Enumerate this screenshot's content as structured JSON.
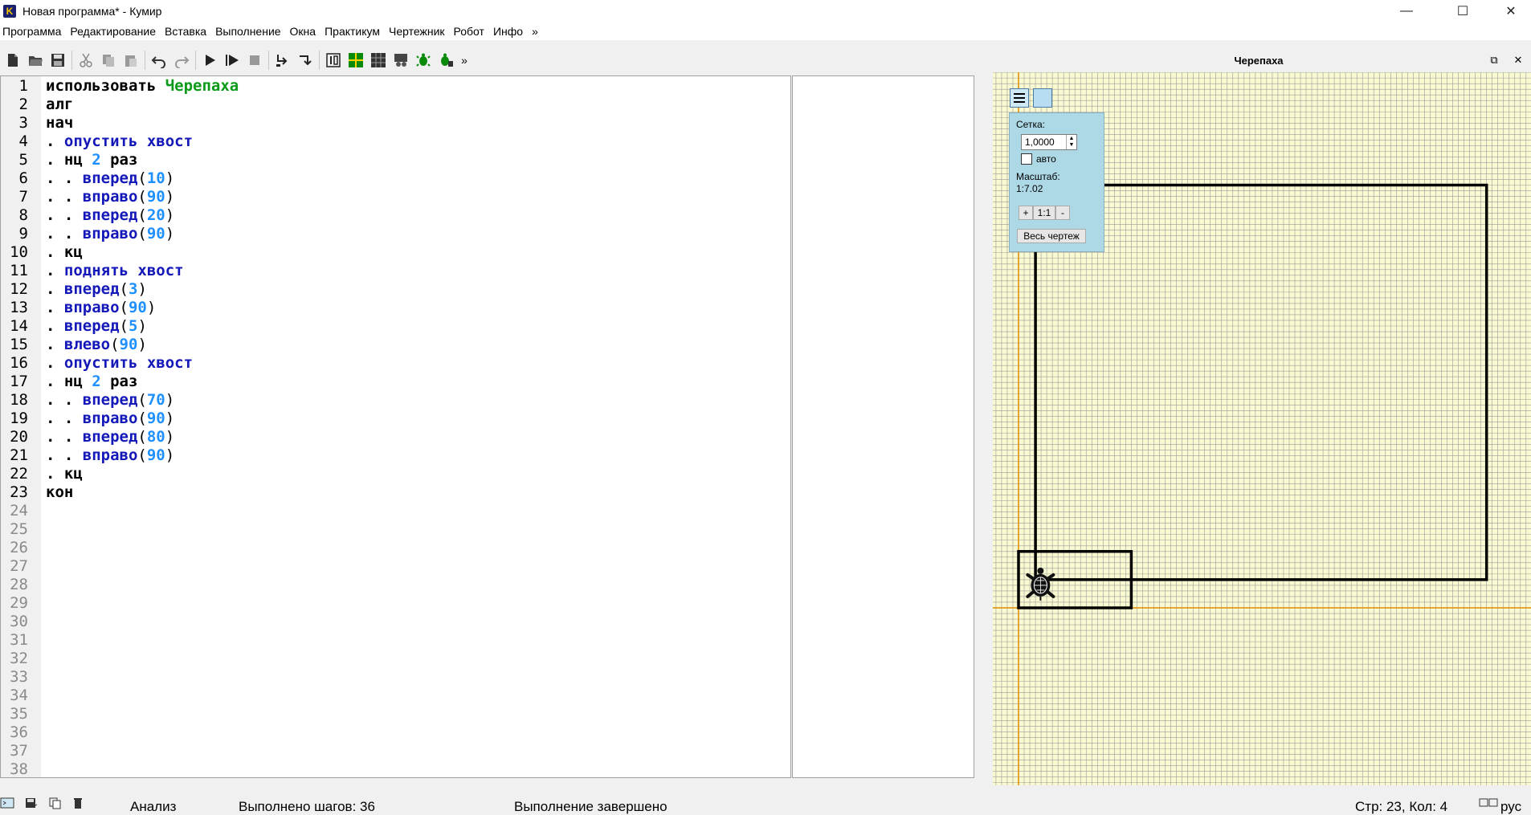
{
  "window": {
    "title": "Новая программа* - Кумир",
    "logo": "K",
    "minimize": "—",
    "maximize": "☐",
    "close": "✕"
  },
  "menu": [
    "Программа",
    "Редактирование",
    "Вставка",
    "Выполнение",
    "Окна",
    "Практикум",
    "Чертежник",
    "Робот",
    "Инфо",
    "»"
  ],
  "toolbar": {
    "icons": [
      "new-file-icon",
      "open-folder-icon",
      "save-icon",
      "cut-icon",
      "copy-icon",
      "paste-icon",
      "undo-icon",
      "redo-icon",
      "run-icon",
      "step-run-icon",
      "stop-icon",
      "step-over-icon",
      "step-into-icon",
      "counter-icon",
      "grid-green-icon",
      "grid-dark-icon",
      "robot-pult-icon",
      "turtle-green-icon",
      "turtle-pult-icon"
    ],
    "overflow": "»"
  },
  "editor": {
    "line_count": 38,
    "lines": [
      [
        {
          "t": "использовать ",
          "c": "plain"
        },
        {
          "t": "Черепаха",
          "c": "green"
        }
      ],
      [
        {
          "t": "алг",
          "c": "plain"
        }
      ],
      [
        {
          "t": "нач",
          "c": "plain"
        }
      ],
      [
        {
          "t": ". ",
          "c": "plain"
        },
        {
          "t": "опустить хвост",
          "c": "blue"
        }
      ],
      [
        {
          "t": ". нц ",
          "c": "plain"
        },
        {
          "t": "2",
          "c": "num"
        },
        {
          "t": " раз",
          "c": "plain"
        }
      ],
      [
        {
          "t": ". . ",
          "c": "plain"
        },
        {
          "t": "вперед",
          "c": "blue"
        },
        {
          "t": "(",
          "c": "paren"
        },
        {
          "t": "10",
          "c": "num"
        },
        {
          "t": ")",
          "c": "paren"
        }
      ],
      [
        {
          "t": ". . ",
          "c": "plain"
        },
        {
          "t": "вправо",
          "c": "blue"
        },
        {
          "t": "(",
          "c": "paren"
        },
        {
          "t": "90",
          "c": "num"
        },
        {
          "t": ")",
          "c": "paren"
        }
      ],
      [
        {
          "t": ". . ",
          "c": "plain"
        },
        {
          "t": "вперед",
          "c": "blue"
        },
        {
          "t": "(",
          "c": "paren"
        },
        {
          "t": "20",
          "c": "num"
        },
        {
          "t": ")",
          "c": "paren"
        }
      ],
      [
        {
          "t": ". . ",
          "c": "plain"
        },
        {
          "t": "вправо",
          "c": "blue"
        },
        {
          "t": "(",
          "c": "paren"
        },
        {
          "t": "90",
          "c": "num"
        },
        {
          "t": ")",
          "c": "paren"
        }
      ],
      [
        {
          "t": ". кц",
          "c": "plain"
        }
      ],
      [
        {
          "t": ". ",
          "c": "plain"
        },
        {
          "t": "поднять хвост",
          "c": "blue"
        }
      ],
      [
        {
          "t": ". ",
          "c": "plain"
        },
        {
          "t": "вперед",
          "c": "blue"
        },
        {
          "t": "(",
          "c": "paren"
        },
        {
          "t": "3",
          "c": "num"
        },
        {
          "t": ")",
          "c": "paren"
        }
      ],
      [
        {
          "t": ". ",
          "c": "plain"
        },
        {
          "t": "вправо",
          "c": "blue"
        },
        {
          "t": "(",
          "c": "paren"
        },
        {
          "t": "90",
          "c": "num"
        },
        {
          "t": ")",
          "c": "paren"
        }
      ],
      [
        {
          "t": ". ",
          "c": "plain"
        },
        {
          "t": "вперед",
          "c": "blue"
        },
        {
          "t": "(",
          "c": "paren"
        },
        {
          "t": "5",
          "c": "num"
        },
        {
          "t": ")",
          "c": "paren"
        }
      ],
      [
        {
          "t": ". ",
          "c": "plain"
        },
        {
          "t": "влево",
          "c": "blue"
        },
        {
          "t": "(",
          "c": "paren"
        },
        {
          "t": "90",
          "c": "num"
        },
        {
          "t": ")",
          "c": "paren"
        }
      ],
      [
        {
          "t": ". ",
          "c": "plain"
        },
        {
          "t": "опустить хвост",
          "c": "blue"
        }
      ],
      [
        {
          "t": ". нц ",
          "c": "plain"
        },
        {
          "t": "2",
          "c": "num"
        },
        {
          "t": " раз",
          "c": "plain"
        }
      ],
      [
        {
          "t": ". . ",
          "c": "plain"
        },
        {
          "t": "вперед",
          "c": "blue"
        },
        {
          "t": "(",
          "c": "paren"
        },
        {
          "t": "70",
          "c": "num"
        },
        {
          "t": ")",
          "c": "paren"
        }
      ],
      [
        {
          "t": ". . ",
          "c": "plain"
        },
        {
          "t": "вправо",
          "c": "blue"
        },
        {
          "t": "(",
          "c": "paren"
        },
        {
          "t": "90",
          "c": "num"
        },
        {
          "t": ")",
          "c": "paren"
        }
      ],
      [
        {
          "t": ". . ",
          "c": "plain"
        },
        {
          "t": "вперед",
          "c": "blue"
        },
        {
          "t": "(",
          "c": "paren"
        },
        {
          "t": "80",
          "c": "num"
        },
        {
          "t": ")",
          "c": "paren"
        }
      ],
      [
        {
          "t": ". . ",
          "c": "plain"
        },
        {
          "t": "вправо",
          "c": "blue"
        },
        {
          "t": "(",
          "c": "paren"
        },
        {
          "t": "90",
          "c": "num"
        },
        {
          "t": ")",
          "c": "paren"
        }
      ],
      [
        {
          "t": ". кц",
          "c": "plain"
        }
      ],
      [
        {
          "t": "кон",
          "c": "plain"
        }
      ]
    ]
  },
  "turtle_panel": {
    "title": "Черепаха",
    "float_icon": "⧉",
    "close_icon": "✕",
    "settings": {
      "grid_label": "Сетка:",
      "grid_value": "1,0000",
      "auto_label": "авто",
      "auto_checked": false,
      "scale_label": "Масштаб:",
      "scale_value": "1:7.02",
      "zoom_in": "+",
      "zoom_reset": "1:1",
      "zoom_out": "-",
      "whole_drawing": "Весь чертеж"
    }
  },
  "status": {
    "analysis": "Анализ",
    "steps": "Выполнено шагов: 36",
    "state": "Выполнение завершено",
    "position": "Стр: 23, Кол: 4",
    "language": "рус"
  },
  "colors": {
    "keyword_blue": "#1418b8",
    "module_green": "#0a9a1a",
    "number_blue": "#1e90ff",
    "canvas_bg": "#fafad2",
    "grid_line": "#9a9a9a",
    "axis_orange": "#e08a00",
    "popup_bg": "#add8e6"
  }
}
